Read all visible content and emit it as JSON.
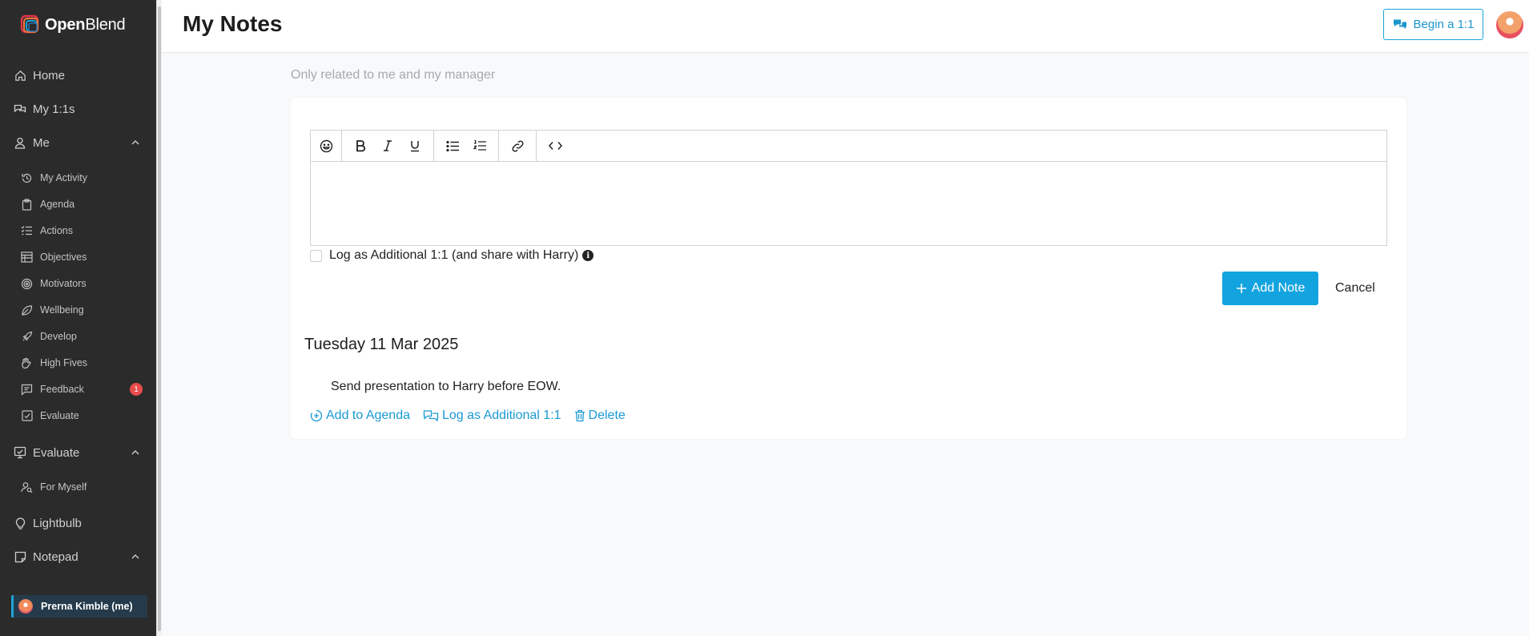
{
  "app": {
    "logo_bold": "Open",
    "logo_light": "Blend"
  },
  "header": {
    "title": "My Notes",
    "begin_label": "Begin a 1:1"
  },
  "sidebar": {
    "top_items": [
      {
        "label": "Home",
        "icon": "home-icon"
      },
      {
        "label": "My 1:1s",
        "icon": "chat-bubbles-icon"
      },
      {
        "label": "Me",
        "icon": "user-icon"
      }
    ],
    "me_items": [
      {
        "label": "My Activity",
        "icon": "history-icon"
      },
      {
        "label": "Agenda",
        "icon": "clipboard-icon"
      },
      {
        "label": "Actions",
        "icon": "checklist-icon"
      },
      {
        "label": "Objectives",
        "icon": "objectives-icon"
      },
      {
        "label": "Motivators",
        "icon": "target-icon"
      },
      {
        "label": "Wellbeing",
        "icon": "leaf-icon"
      },
      {
        "label": "Develop",
        "icon": "rocket-icon"
      },
      {
        "label": "High Fives",
        "icon": "high-five-icon"
      },
      {
        "label": "Feedback",
        "icon": "feedback-icon",
        "badge": "1"
      },
      {
        "label": "Evaluate",
        "icon": "evaluate-icon"
      }
    ],
    "evaluate": {
      "label": "Evaluate",
      "icon": "evaluate-board-icon"
    },
    "evaluate_items": [
      {
        "label": "For Myself",
        "icon": "user-search-icon"
      }
    ],
    "lightbulb": {
      "label": "Lightbulb",
      "icon": "lightbulb-icon"
    },
    "notepad": {
      "label": "Notepad",
      "icon": "note-icon"
    },
    "current_user": "Prerna Kimble (me)"
  },
  "main": {
    "subtitle": "Only related to me and my manager",
    "share_label": "Log as Additional 1:1 (and share with Harry)",
    "share_checked": false,
    "add_note_label": "Add Note",
    "cancel_label": "Cancel",
    "toolbar_icons": [
      "emoji-icon",
      "bold-icon",
      "italic-icon",
      "underline-icon",
      "bullet-list-icon",
      "numbered-list-icon",
      "link-icon",
      "code-icon"
    ],
    "notes": [
      {
        "date": "Tuesday 11 Mar 2025",
        "text": "Send presentation to Harry before EOW.",
        "actions": {
          "agenda": "Add to Agenda",
          "log": "Log as Additional 1:1",
          "delete": "Delete"
        }
      }
    ]
  },
  "colors": {
    "sidebar_bg": "#2b2b2b",
    "accent": "#13a4e0",
    "badge": "#e84c4c",
    "link": "#1a9ad4"
  }
}
